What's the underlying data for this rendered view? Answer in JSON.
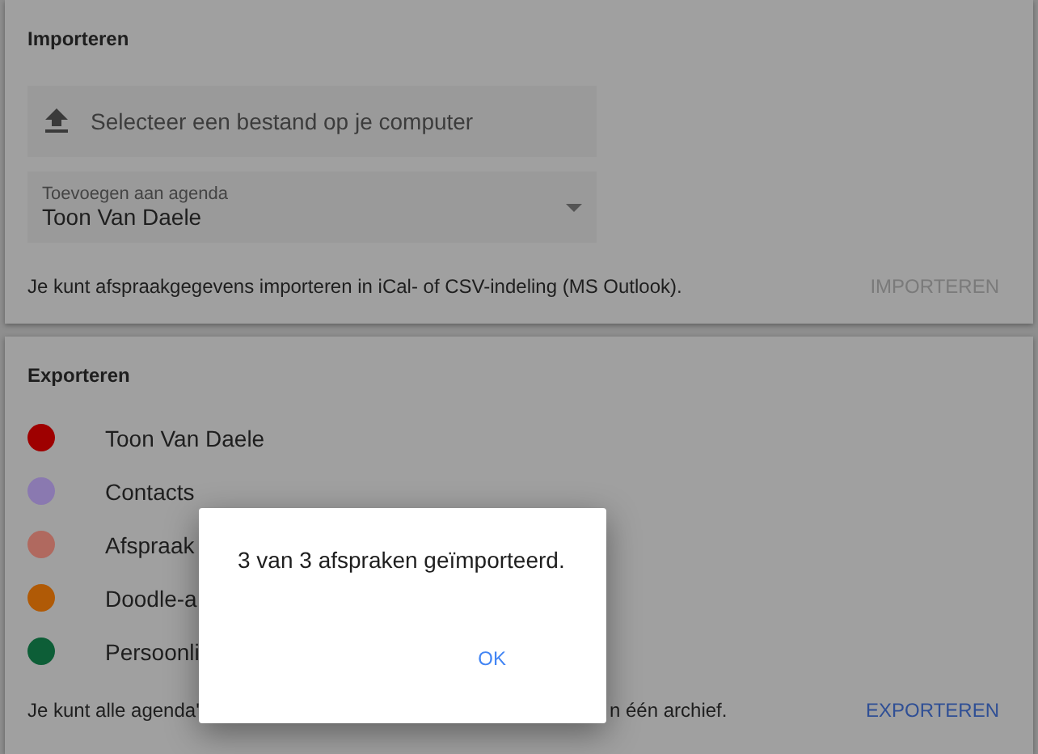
{
  "import_card": {
    "title": "Importeren",
    "upload_label": "Selecteer een bestand op je computer",
    "calendar_select": {
      "label": "Toevoegen aan agenda",
      "value": "Toon Van Daele"
    },
    "hint": "Je kunt afspraakgegevens importeren in iCal- of CSV-indeling (MS Outlook).",
    "action": "IMPORTEREN",
    "action_disabled": true
  },
  "export_card": {
    "title": "Exporteren",
    "calendars": [
      {
        "name": "Toon Van Daele",
        "color": "#9e0000"
      },
      {
        "name": "Contacts",
        "color": "#8a79b0"
      },
      {
        "name": "Afspraak",
        "color": "#b0695f"
      },
      {
        "name": "Doodle-a",
        "color": "#b05a06"
      },
      {
        "name": "Persoonli",
        "color": "#0d5e37"
      }
    ],
    "hint_start": "Je kunt alle agenda'",
    "hint_end": "n één archief.",
    "action": "EXPORTEREN",
    "action_disabled": false
  },
  "dialog": {
    "message": "3 van 3 afspraken geïmporteerd.",
    "button": "OK"
  }
}
